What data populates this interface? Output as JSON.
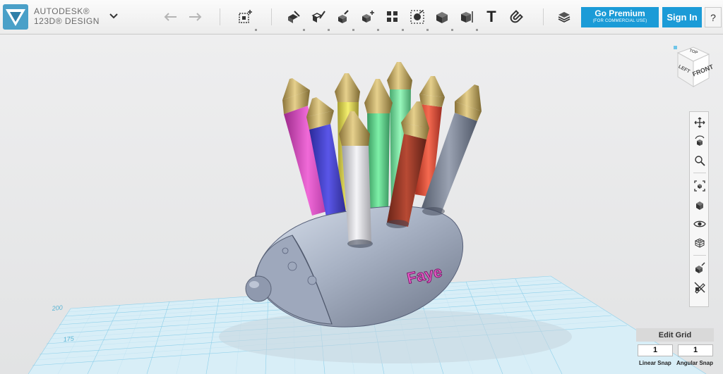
{
  "app": {
    "brand_line1": "AUTODESK®",
    "brand_line2": "123D® DESIGN",
    "accent": "#1b9bd7"
  },
  "toolbar": {
    "undo_icon": "undo-arrow",
    "redo_icon": "redo-arrow",
    "tools": [
      "primitives-icon",
      "sketch-icon",
      "construct-icon",
      "modify-icon",
      "pattern-icon",
      "group-icon",
      "combine-icon",
      "measure-icon",
      "text-icon",
      "snap-icon",
      "material-icon"
    ],
    "text_tool_glyph": "T"
  },
  "account": {
    "premium_label": "Go Premium",
    "premium_sub": "(FOR COMMERCIAL USE)",
    "signin_label": "Sign In",
    "help_label": "?"
  },
  "viewcube": {
    "top": "TOP",
    "left": "LEFT",
    "front": "FRONT"
  },
  "nav": {
    "items": [
      "pan",
      "orbit",
      "zoom",
      "fit",
      "views",
      "visibility",
      "materials-outlines",
      "add-icon",
      "eraser"
    ]
  },
  "scene": {
    "name_text": "Faye",
    "grid_labels": [
      "200",
      "175"
    ]
  },
  "grid_panel": {
    "edit_grid_label": "Edit Grid",
    "linear_snap_value": "1",
    "angular_snap_value": "1",
    "linear_snap_label": "Linear Snap",
    "angular_snap_label": "Angular Snap"
  }
}
